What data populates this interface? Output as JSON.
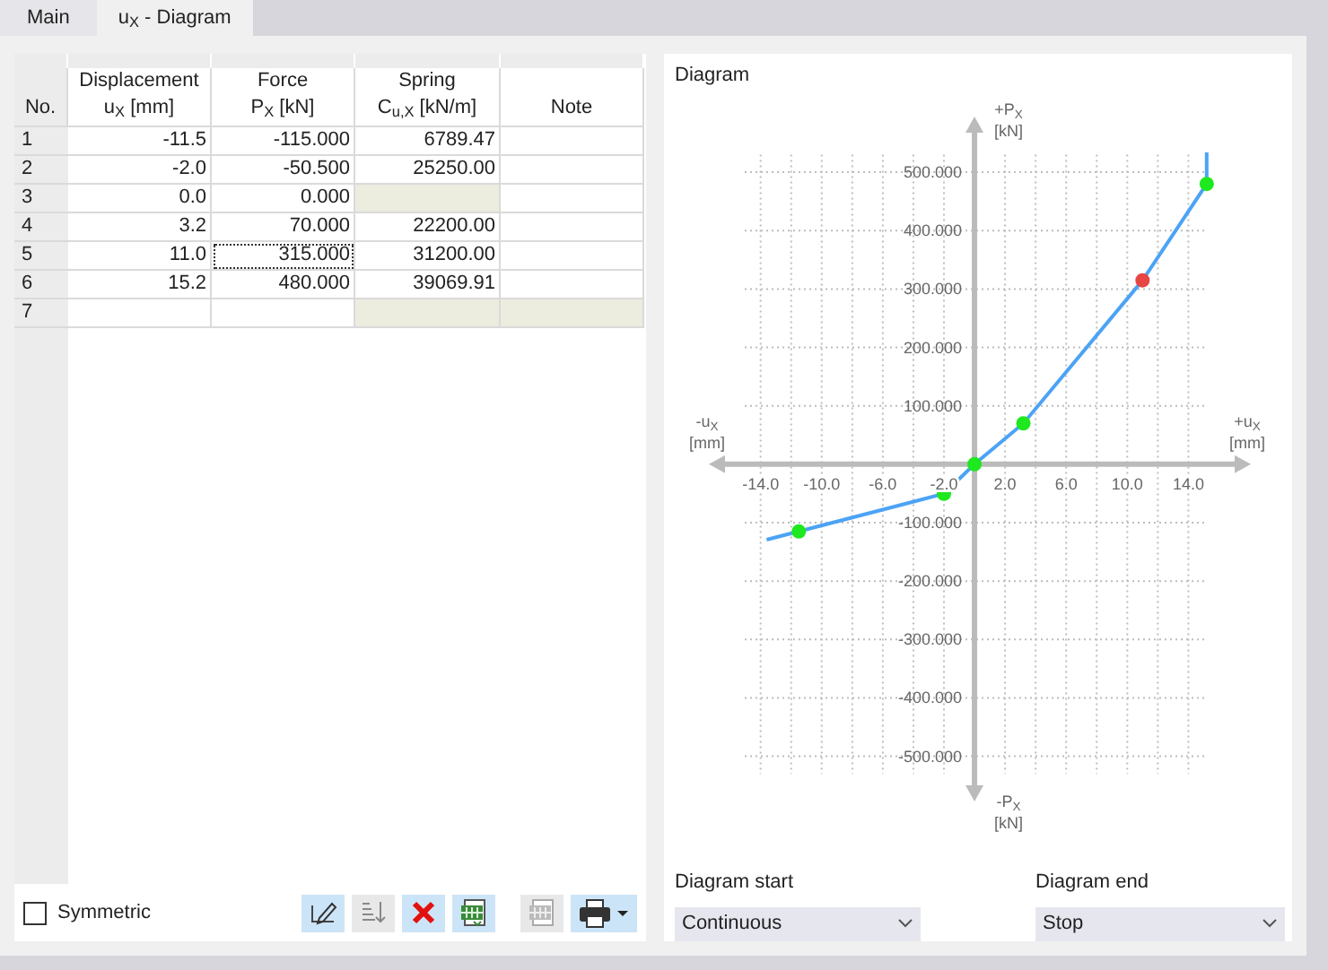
{
  "tabs": [
    {
      "label": "Main",
      "selected": false
    },
    {
      "label": "u$_{X}$ - Diagram",
      "selected": true
    }
  ],
  "table": {
    "columns": [
      {
        "label": "No."
      },
      {
        "label": "Displacement",
        "unit": "u$_{X}$ [mm]"
      },
      {
        "label": "Force",
        "unit": "P$_{X}$ [kN]"
      },
      {
        "label": "Spring",
        "unit": "C$_{u,X}$ [kN/m]"
      },
      {
        "label": "Note"
      }
    ],
    "rows": [
      {
        "no": "1",
        "ux": "-11.5",
        "px": "-115.000",
        "spring": "6789.47",
        "spring_disabled": false,
        "note_disabled": false,
        "selected": false
      },
      {
        "no": "2",
        "ux": "-2.0",
        "px": "-50.500",
        "spring": "25250.00",
        "spring_disabled": false,
        "note_disabled": false,
        "selected": false
      },
      {
        "no": "3",
        "ux": "0.0",
        "px": "0.000",
        "spring_disabled": true,
        "note_disabled": false,
        "selected": false
      },
      {
        "no": "4",
        "ux": "3.2",
        "px": "70.000",
        "spring": "22200.00",
        "spring_disabled": false,
        "note_disabled": false,
        "selected": false
      },
      {
        "no": "5",
        "ux": "11.0",
        "px": "315.000",
        "spring": "31200.00",
        "spring_disabled": false,
        "note_disabled": false,
        "selected": true
      },
      {
        "no": "6",
        "ux": "15.2",
        "px": "480.000",
        "spring": "39069.91",
        "spring_disabled": false,
        "note_disabled": false,
        "selected": false
      },
      {
        "no": "7",
        "spring_disabled": true,
        "note_disabled": true,
        "selected": false
      }
    ]
  },
  "symmetric": {
    "label": "Symmetric",
    "checked": false
  },
  "toolbar": [
    {
      "kind": "edit",
      "disabled": false
    },
    {
      "kind": "sort",
      "disabled": true
    },
    {
      "kind": "delete",
      "disabled": false
    },
    {
      "kind": "export",
      "disabled": false
    },
    {
      "kind": "import",
      "disabled": true
    },
    {
      "kind": "print",
      "disabled": false
    }
  ],
  "diagram": {
    "title": "Diagram",
    "axis_labels": {
      "y_pos": [
        "+P$_{X}$",
        "[kN]"
      ],
      "y_neg": [
        "-P$_{X}$",
        "[kN]"
      ],
      "x_neg": [
        "-u$_{X}$",
        "[mm]"
      ],
      "x_pos": [
        "+u$_{X}$",
        "[mm]"
      ]
    },
    "chart_data": {
      "type": "line",
      "x": [
        -13.6,
        -11.5,
        -2.0,
        0.0,
        3.2,
        11.0,
        15.2,
        15.2
      ],
      "series": [
        {
          "color": "#4ca3f5",
          "values": [
            -129,
            -115,
            -50.5,
            0,
            70,
            315,
            480,
            534
          ]
        }
      ],
      "xlim": [
        -16.8,
        17.5
      ],
      "ylim": [
        -562,
        580
      ],
      "grid": true,
      "xticks": [
        {
          "value": -14,
          "label": "-14.0"
        },
        {
          "value": -10,
          "label": "-10.0"
        },
        {
          "value": -6,
          "label": "-6.0"
        },
        {
          "value": -2,
          "label": "-2.0"
        },
        {
          "value": 2,
          "label": "2.0"
        },
        {
          "value": 6,
          "label": "6.0"
        },
        {
          "value": 10,
          "label": "10.0"
        },
        {
          "value": 14,
          "label": "14.0"
        }
      ],
      "yticks": [
        {
          "value": 500,
          "label": "500.000"
        },
        {
          "value": 400,
          "label": "400.000"
        },
        {
          "value": 300,
          "label": "300.000"
        },
        {
          "value": 200,
          "label": "200.000"
        },
        {
          "value": 100,
          "label": "100.000"
        },
        {
          "value": -100,
          "label": "-100.000"
        },
        {
          "value": -200,
          "label": "-200.000"
        },
        {
          "value": -300,
          "label": "-300.000"
        },
        {
          "value": -400,
          "label": "-400.000"
        },
        {
          "value": -500,
          "label": "-500.000"
        }
      ]
    }
  },
  "diagram_start": {
    "label": "Diagram start",
    "value": "Continuous"
  },
  "diagram_end": {
    "label": "Diagram end",
    "value": "Stop"
  }
}
